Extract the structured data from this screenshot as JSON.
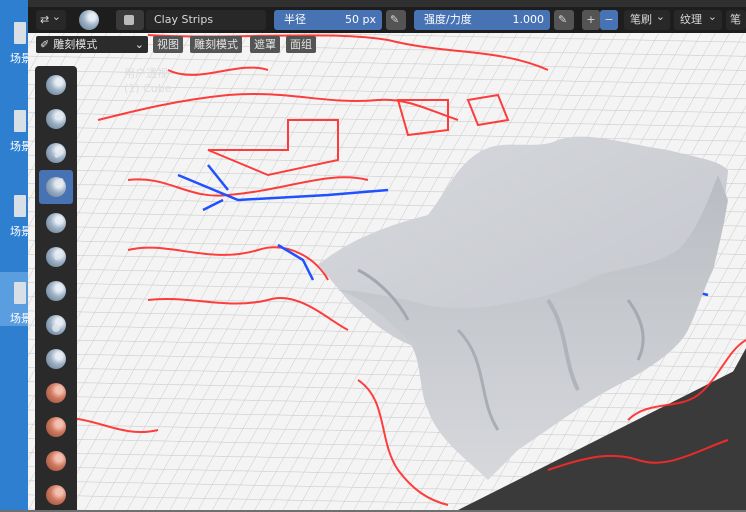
{
  "desktop": {
    "items": [
      {
        "label": "场景"
      },
      {
        "label": "场景"
      },
      {
        "label": "场景"
      },
      {
        "label": "场景",
        "selected": true
      }
    ]
  },
  "header": {
    "mode_icon": "sculpt-grab-icon",
    "brush_icon": "clay-strips-brush-icon",
    "brush_name": "Clay Strips",
    "radius_label": "半径",
    "radius_value": "50 px",
    "strength_label": "强度/力度",
    "strength_value": "1.000",
    "plus": "+",
    "minus": "−",
    "brush_menu": "笔刷",
    "texture_menu": "纹理",
    "stroke_menu": "笔"
  },
  "toolbar2": {
    "mode_label": "雕刻模式",
    "view_menu": "视图",
    "sculpt_menu": "雕刻模式",
    "mask_menu": "遮罩",
    "face_sets_menu": "面组"
  },
  "overlay": {
    "line1": "用户透视",
    "line2": "(1) Cube"
  },
  "tools": [
    "draw-brush-icon",
    "draw-sharp-brush-icon",
    "clay-brush-icon",
    "clay-strips-brush-icon",
    "clay-thumb-brush-icon",
    "layer-brush-icon",
    "inflate-brush-icon",
    "blob-brush-icon",
    "crease-brush-icon",
    "smooth-brush-icon",
    "flatten-brush-icon",
    "fill-brush-icon",
    "scrape-brush-icon"
  ],
  "colors": {
    "accent": "#4772b3",
    "header_bg": "#1d1d1d",
    "toolbar_bg": "#2a2a2a",
    "desktop_bg": "#2f7fd0",
    "grid_bg": "#f4f4f4",
    "curve_red": "#ff2020",
    "curve_blue": "#2050ff",
    "mesh_gray": "#c9ccd2"
  }
}
